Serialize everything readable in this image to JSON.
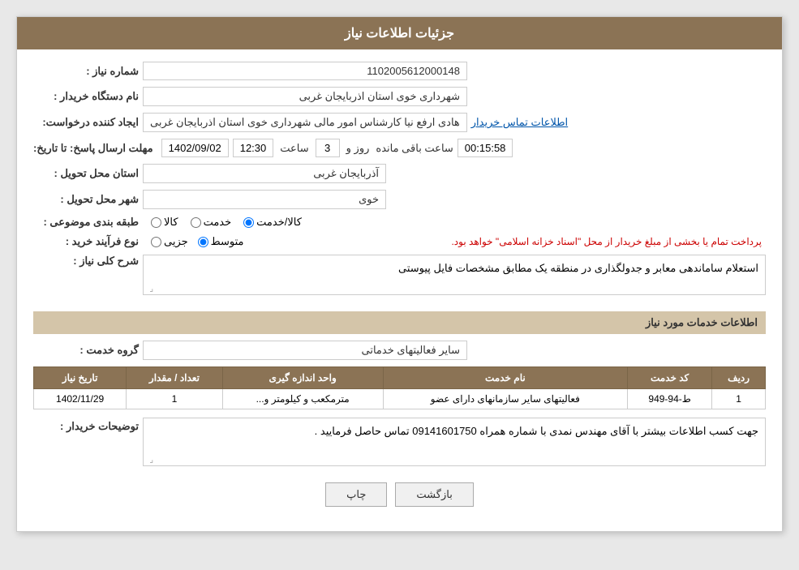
{
  "header": {
    "title": "جزئیات اطلاعات نیاز"
  },
  "fields": {
    "request_number_label": "شماره نیاز :",
    "request_number_value": "1102005612000148",
    "buyer_org_label": "نام دستگاه خریدار :",
    "buyer_org_value": "شهرداری خوی استان اذربایجان غربی",
    "creator_label": "ایجاد کننده درخواست:",
    "creator_value": "هادی ارفع نیا کارشناس امور مالی شهرداری خوی استان اذربایجان غربی",
    "contact_link": "اطلاعات تماس خریدار",
    "deadline_label": "مهلت ارسال پاسخ: تا تاریخ:",
    "deadline_date": "1402/09/02",
    "deadline_time_label": "ساعت",
    "deadline_time": "12:30",
    "deadline_days_label": "روز و",
    "deadline_days": "3",
    "deadline_remaining_label": "ساعت باقی مانده",
    "deadline_remaining": "00:15:58",
    "province_label": "استان محل تحویل :",
    "province_value": "آذربایجان غربی",
    "city_label": "شهر محل تحویل :",
    "city_value": "خوی",
    "category_label": "طبقه بندی موضوعی :",
    "category_options": [
      {
        "label": "کالا",
        "name": "category",
        "checked": false
      },
      {
        "label": "خدمت",
        "name": "category",
        "checked": false
      },
      {
        "label": "کالا/خدمت",
        "name": "category",
        "checked": true
      }
    ],
    "purchase_type_label": "نوع فرآیند خرید :",
    "purchase_type_options": [
      {
        "label": "جزیی",
        "name": "purchase",
        "checked": false
      },
      {
        "label": "متوسط",
        "name": "purchase",
        "checked": true
      }
    ],
    "purchase_note": "پرداخت تمام یا بخشی از مبلغ خریدار از محل \"اسناد خزانه اسلامی\" خواهد بود.",
    "description_label": "شرح کلی نیاز :",
    "description_value": "استعلام ساماندهی معابر و جدولگذاری در منطقه یک مطابق مشخصات فایل پیوستی",
    "services_section_label": "اطلاعات خدمات مورد نیاز",
    "service_group_label": "گروه خدمت :",
    "service_group_value": "سایر فعالیتهای خدماتی",
    "table": {
      "headers": [
        "ردیف",
        "کد خدمت",
        "نام خدمت",
        "واحد اندازه گیری",
        "تعداد / مقدار",
        "تاریخ نیاز"
      ],
      "rows": [
        {
          "row_num": "1",
          "service_code": "ط-94-949",
          "service_name": "فعالیتهای سایر سازمانهای دارای عضو",
          "unit": "مترمکعب و کیلومتر و...",
          "quantity": "1",
          "date": "1402/11/29"
        }
      ]
    },
    "buyer_notes_label": "توضیحات خریدار :",
    "buyer_notes_value": "جهت کسب اطلاعات بیشتر با آقای مهندس نمدی با شماره همراه 09141601750 تماس حاصل فرمایید ."
  },
  "buttons": {
    "print_label": "چاپ",
    "back_label": "بازگشت"
  }
}
